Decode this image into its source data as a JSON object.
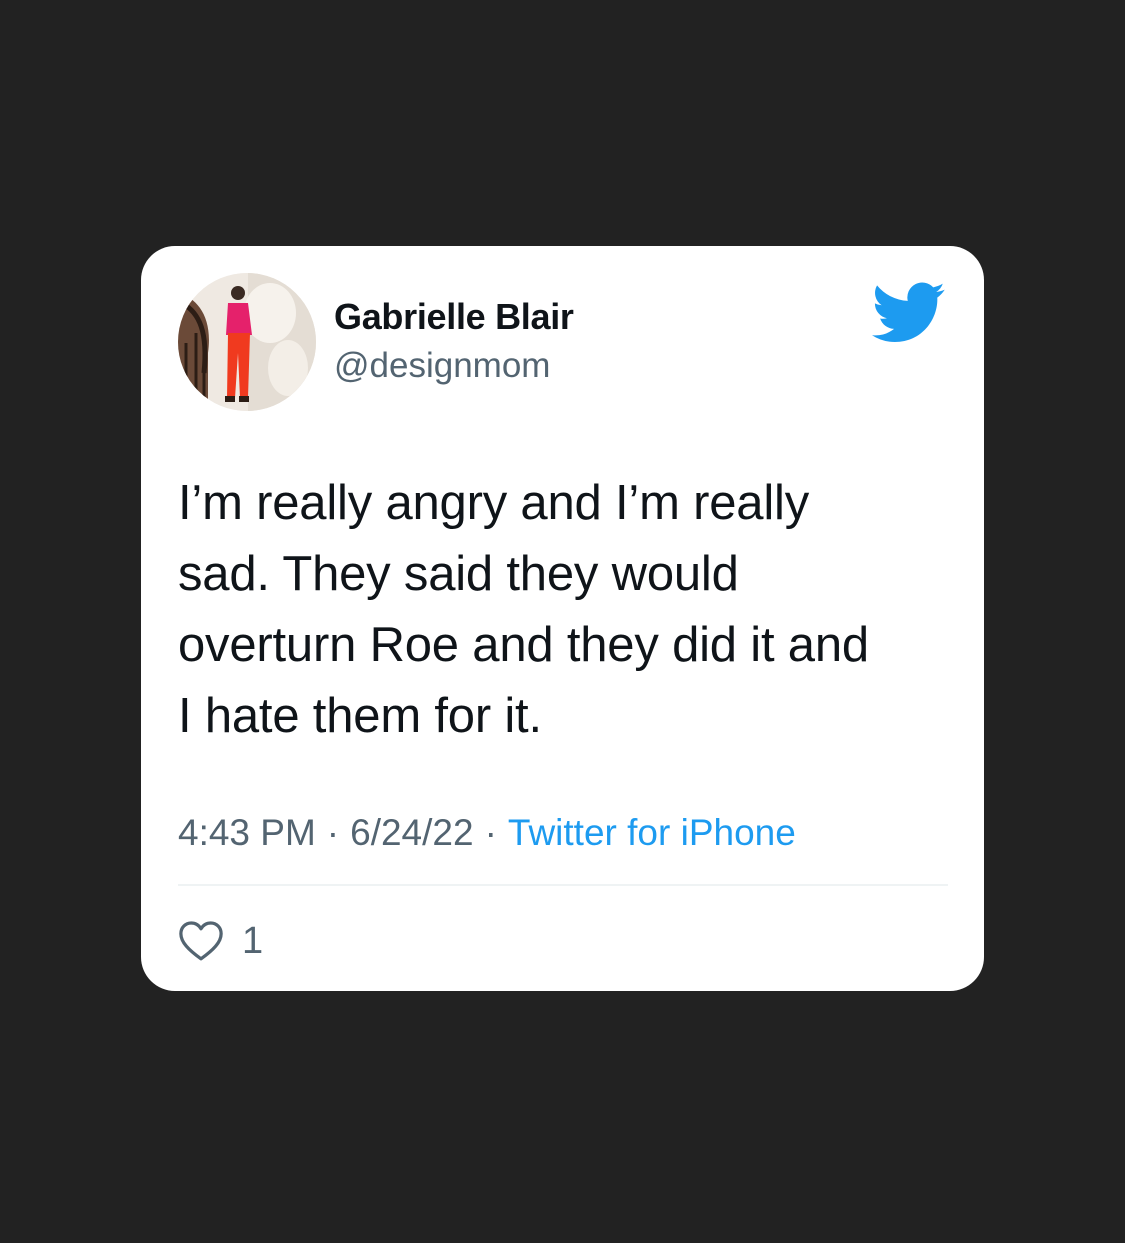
{
  "tweet": {
    "author": {
      "display_name": "Gabrielle Blair",
      "handle": "@designmom"
    },
    "text_lines": [
      "I’m really angry and I’m really",
      "sad. They said they would",
      "overturn Roe and they did it and",
      "I hate them for it."
    ],
    "time": "4:43 PM",
    "date": "6/24/22",
    "separator": "·",
    "source": "Twitter for iPhone",
    "like_count": "1"
  },
  "icons": {
    "logo": "twitter-bird-icon",
    "like": "heart-icon"
  },
  "colors": {
    "background": "#222222",
    "card": "#ffffff",
    "text_primary": "#0f1419",
    "text_secondary": "#536471",
    "accent": "#1d9bf0"
  }
}
